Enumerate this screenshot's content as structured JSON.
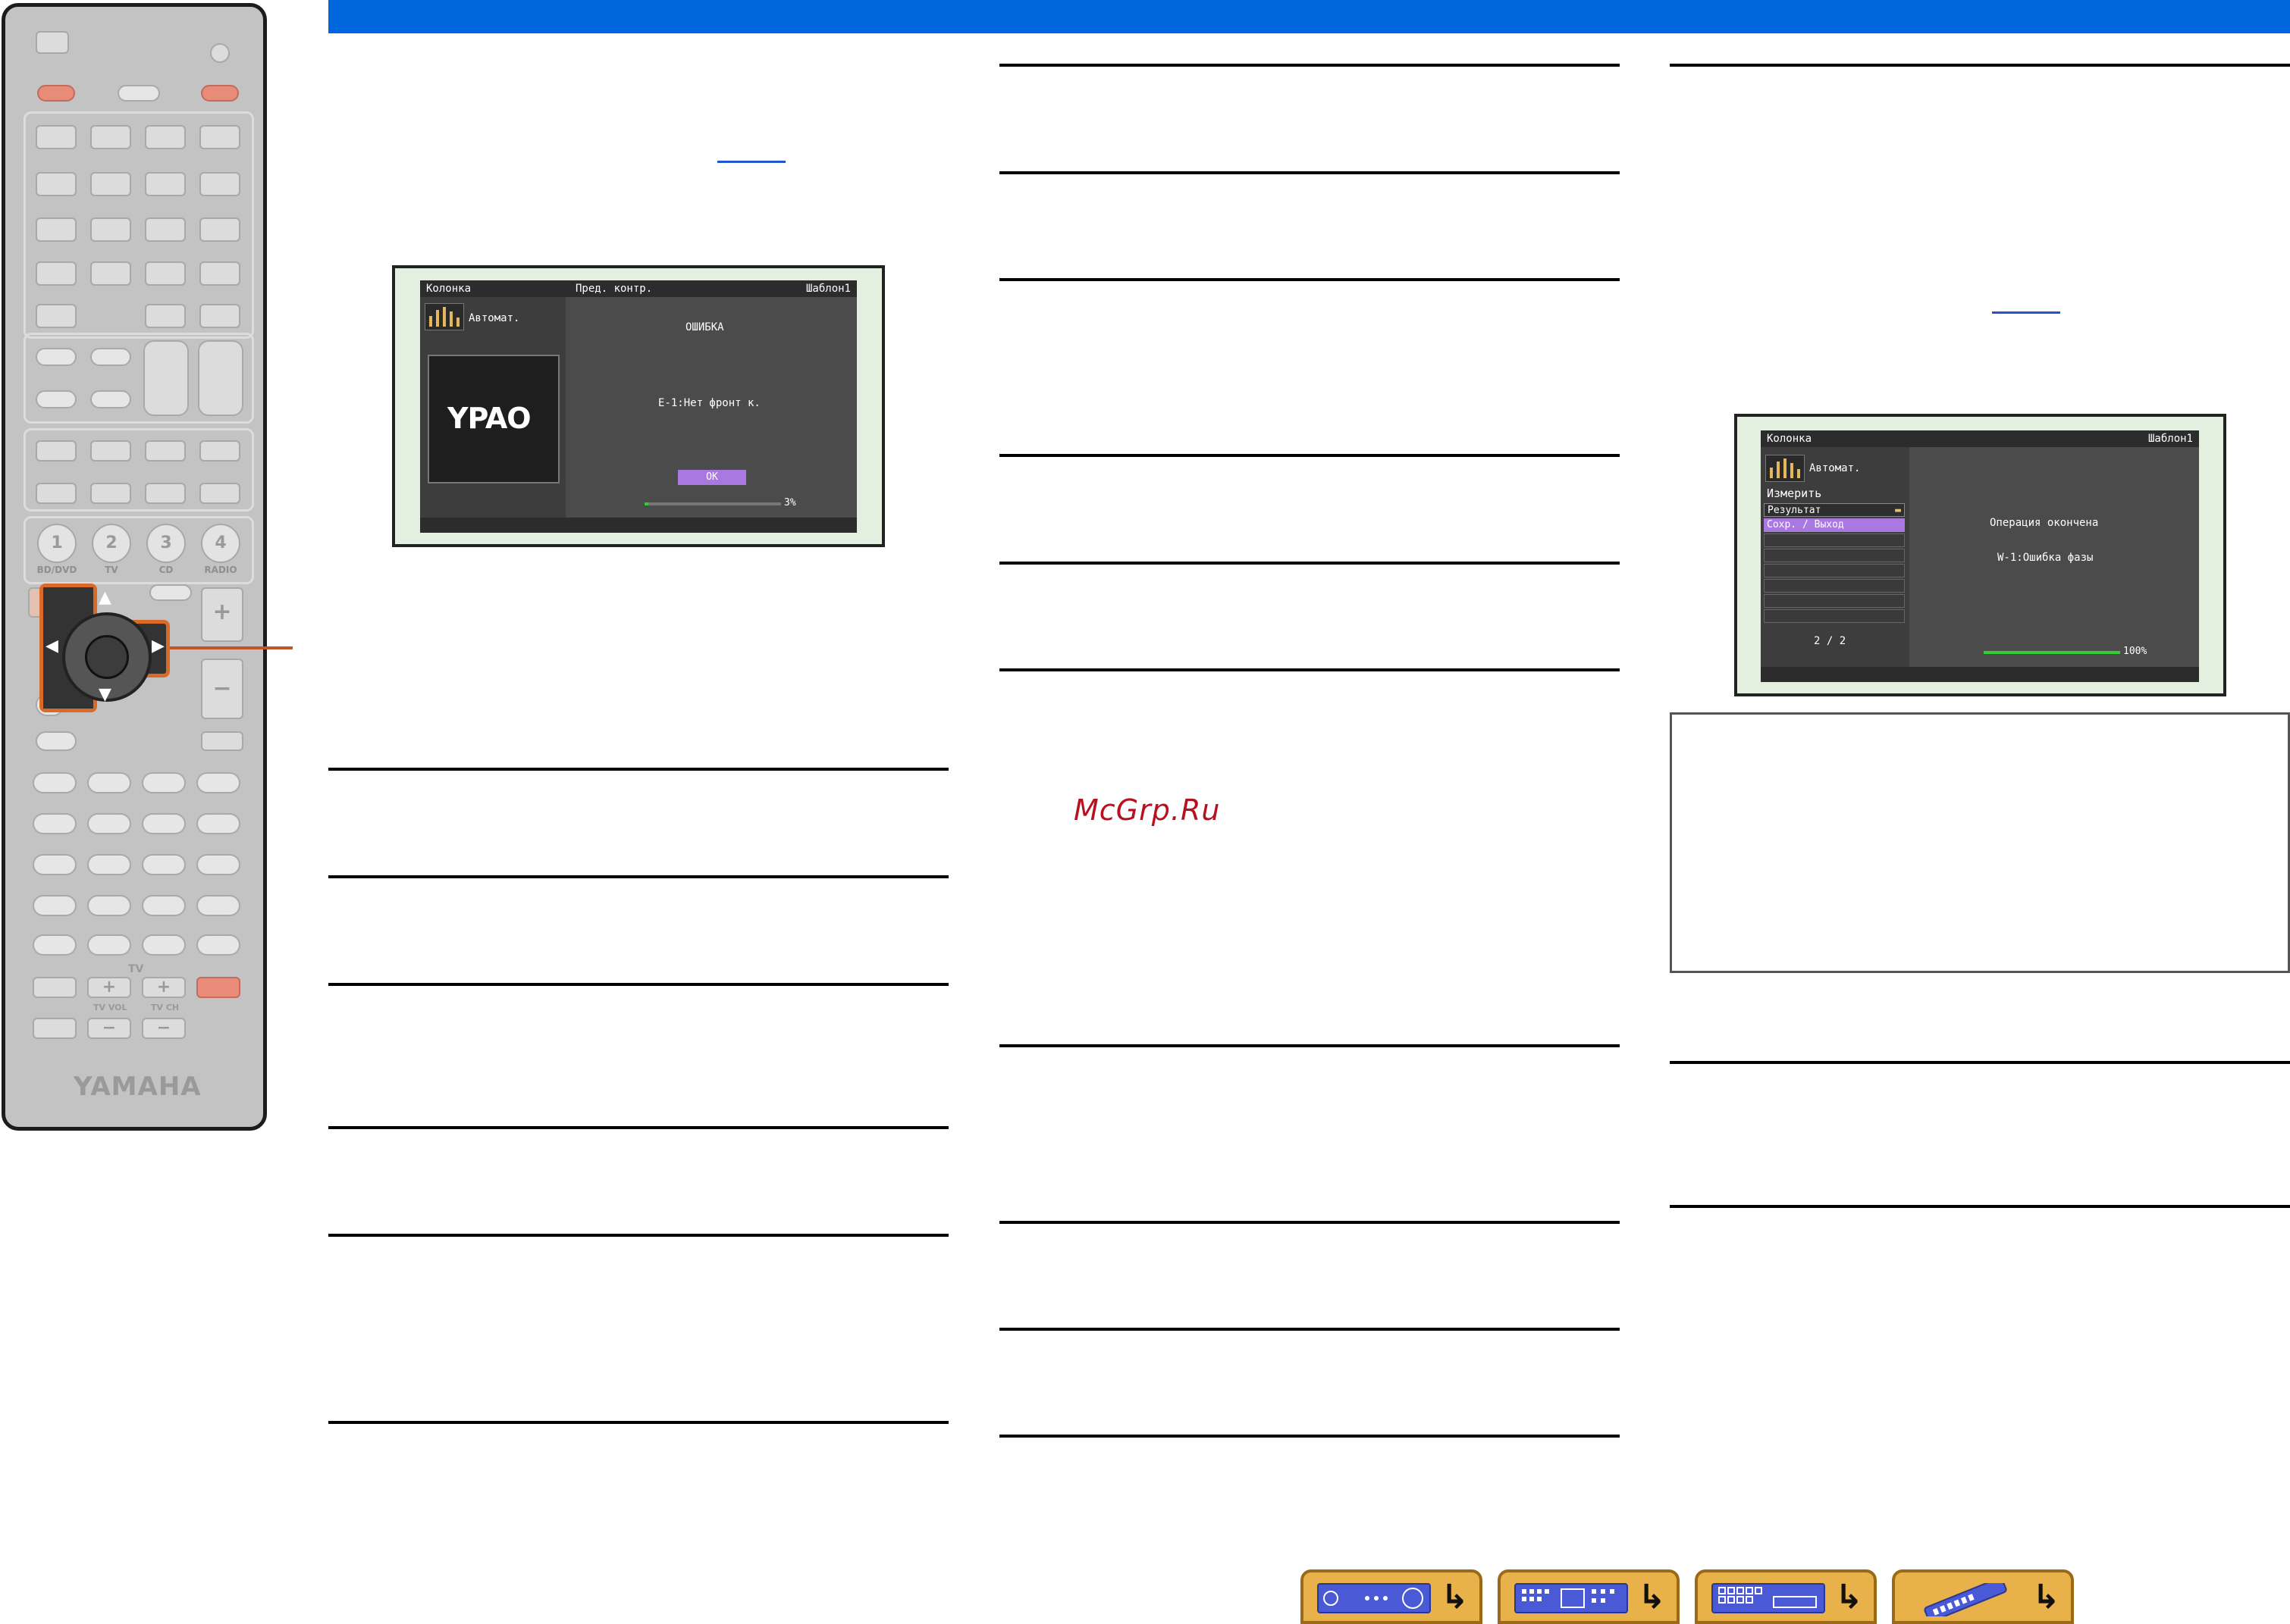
{
  "remote": {
    "num_keys": [
      "1",
      "2",
      "3",
      "4"
    ],
    "num_labels": [
      "BD/DVD",
      "TV",
      "CD",
      "RADIO"
    ],
    "tv_label": "TV",
    "tv_vol_label": "TV VOL",
    "tv_ch_label": "TV CH",
    "plus": "+",
    "minus": "−",
    "brand": "YAMAHA"
  },
  "screen1": {
    "header_left": "Колонка",
    "header_mid": "Пред. контр.",
    "header_right": "Шаблон1",
    "mode": "Автомат.",
    "logo": "YPAO",
    "error_title": "ОШИБКА",
    "error_msg": "E-1:Нет фронт к.",
    "ok": "OK",
    "progress_text": "3%",
    "progress": 0.03
  },
  "screen2": {
    "header_left": "Колонка",
    "header_right": "Шаблон1",
    "mode": "Автомат.",
    "menu_title": "Измерить",
    "menu_items": [
      "Результат",
      "Сохр. / Выход"
    ],
    "page": "2 / 2",
    "status": "Операция окончена",
    "warning": "W-1:Ошибка фазы",
    "progress_text": "100%",
    "progress": 1.0
  },
  "watermark": "McGrp.Ru",
  "colors": {
    "topbar": "#0066dd",
    "highlight": "#d96a28",
    "menu_selected": "#a978e0",
    "progress": "#33cc33",
    "nav_button": "#e8b14a"
  },
  "nav": {
    "buttons": [
      "receiver-icon",
      "front-panel-icon",
      "rear-panel-icon",
      "remote-icon"
    ],
    "return_glyph": "↳"
  }
}
